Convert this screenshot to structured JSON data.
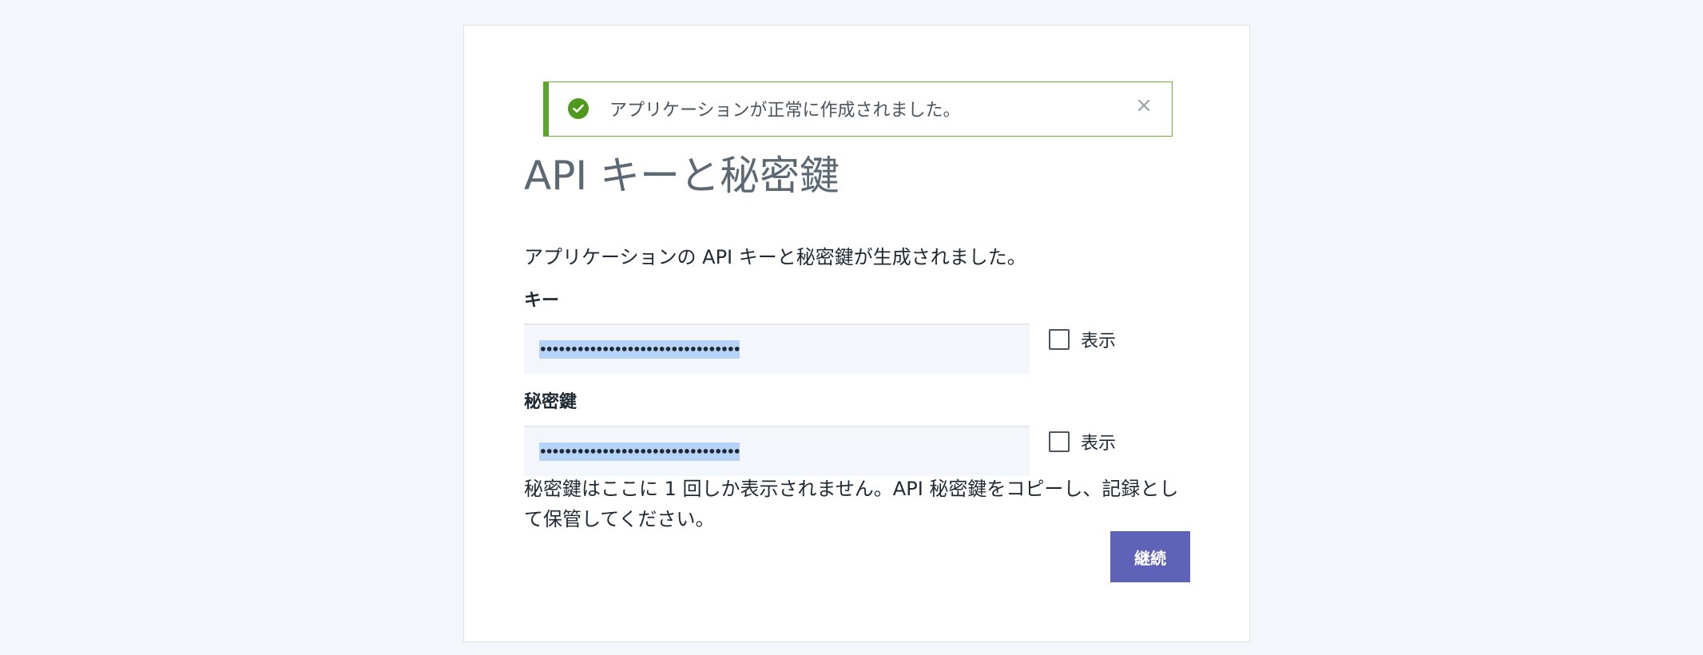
{
  "alert": {
    "message": "アプリケーションが正常に作成されました。",
    "close_symbol": "×",
    "icon": "check-circle-icon",
    "accent_color": "#5aa52b"
  },
  "page": {
    "title": "API キーと秘密鍵",
    "description": "アプリケーションの API キーと秘密鍵が生成されました。"
  },
  "key_field": {
    "label": "キー",
    "masked_value": "••••••••••••••••••••••••••••••••",
    "show_label": "表示",
    "show_checked": false
  },
  "secret_field": {
    "label": "秘密鍵",
    "masked_value": "••••••••••••••••••••••••••••••••",
    "show_label": "表示",
    "show_checked": false
  },
  "note": "秘密鍵はここに 1 回しか表示されません。API 秘密鍵をコピーし、記録として保管してください。",
  "actions": {
    "continue_label": "継続",
    "continue_color": "#5f63b8"
  }
}
